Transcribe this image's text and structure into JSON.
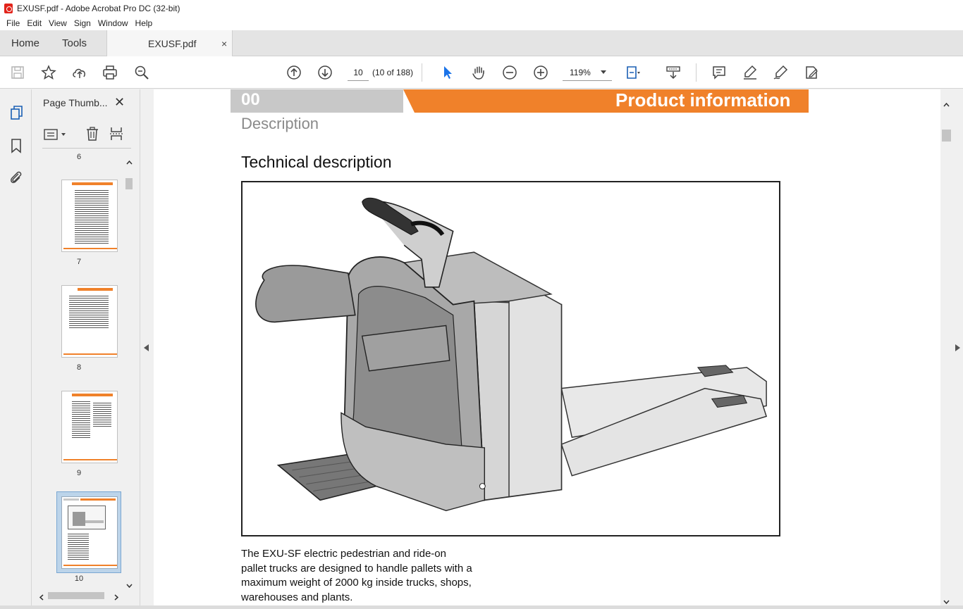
{
  "window": {
    "title": "EXUSF.pdf - Adobe Acrobat Pro DC (32-bit)"
  },
  "menu": [
    "File",
    "Edit",
    "View",
    "Sign",
    "Window",
    "Help"
  ],
  "tabs": {
    "home": "Home",
    "tools": "Tools",
    "document": "EXUSF.pdf",
    "close": "×"
  },
  "toolbar": {
    "page_current": "10",
    "page_count": "(10 of 188)",
    "zoom": "119%"
  },
  "thumbnails_panel": {
    "title": "Page Thumb...",
    "close": "✕",
    "pages": [
      {
        "label": "6"
      },
      {
        "label": "7"
      },
      {
        "label": "8"
      },
      {
        "label": "9"
      },
      {
        "label": "10",
        "selected": true
      }
    ]
  },
  "document": {
    "banner_number": "00",
    "banner_title": "Product information",
    "section": "Description",
    "heading": "Technical description",
    "body_lines": [
      "The EXU-SF electric pedestrian and ride-on",
      "pallet trucks are designed to handle pallets with a",
      "maximum weight of 2000 kg inside trucks, shops,",
      "warehouses and plants."
    ]
  },
  "colors": {
    "accent_orange": "#f0812a",
    "selection_blue": "#1a73e8",
    "pdf_red": "#e2231a"
  }
}
